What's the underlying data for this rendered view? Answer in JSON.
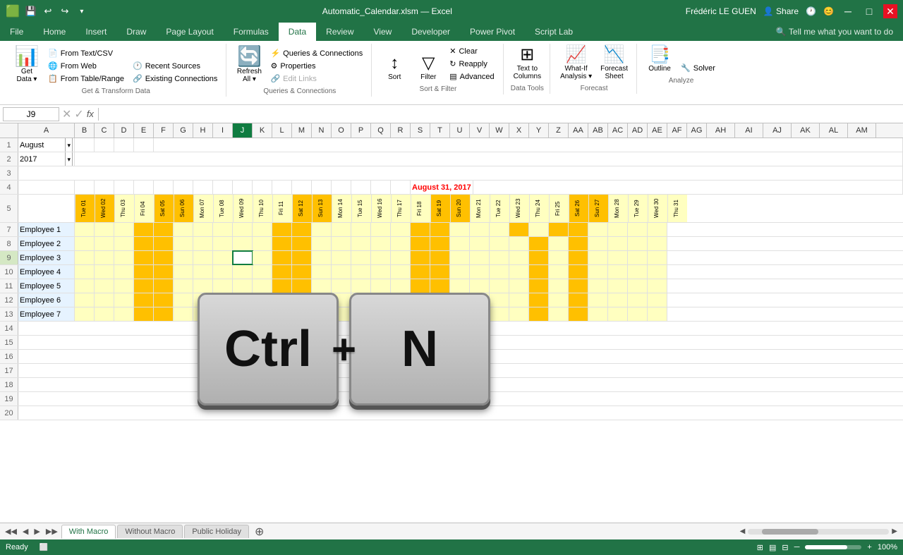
{
  "titleBar": {
    "filename": "Automatic_Calendar.xlsm — Excel",
    "user": "Frédéric LE GUEN",
    "saveIcon": "💾",
    "undoIcon": "↩",
    "redoIcon": "↪"
  },
  "ribbon": {
    "tabs": [
      "File",
      "Home",
      "Insert",
      "Draw",
      "Page Layout",
      "Formulas",
      "Data",
      "Review",
      "View",
      "Developer",
      "Power Pivot",
      "Script Lab"
    ],
    "activeTab": "Data",
    "groups": {
      "getTransform": {
        "label": "Get & Transform Data",
        "getDataBtn": "Get Data",
        "fromTextCSV": "From Text/CSV",
        "fromWeb": "From Web",
        "fromTableRange": "From Table/Range",
        "recentSources": "Recent Sources",
        "existingConnections": "Existing Connections",
        "refreshAll": "Refresh All"
      },
      "queriesConnections": {
        "label": "Queries & Connections",
        "queriesConnections": "Queries & Connections",
        "properties": "Properties",
        "editLinks": "Edit Links"
      },
      "sortFilter": {
        "label": "Sort & Filter",
        "sort": "Sort",
        "filter": "Filter",
        "clear": "Clear",
        "reapply": "Reapply",
        "advanced": "Advanced"
      },
      "dataTools": {
        "label": "Data Tools",
        "textToColumns": "Text to Columns"
      },
      "forecast": {
        "label": "Forecast",
        "whatIfAnalysis": "What-If Analysis",
        "forecastSheet": "Forecast Sheet"
      },
      "analyze": {
        "label": "Analyze",
        "solver": "Solver",
        "outline": "Outline"
      }
    }
  },
  "formulaBar": {
    "cellRef": "J9",
    "formula": ""
  },
  "sheet": {
    "colHeaders": [
      "A",
      "B",
      "C",
      "D",
      "E",
      "F",
      "G",
      "H",
      "I",
      "J",
      "K",
      "L",
      "M",
      "N",
      "O",
      "P",
      "Q",
      "R",
      "S",
      "T",
      "U",
      "V",
      "W",
      "X",
      "Y",
      "Z",
      "AA",
      "AB",
      "AC",
      "AD",
      "AE",
      "AF",
      "AG",
      "AH",
      "AI",
      "AJ",
      "AK",
      "AL",
      "AM"
    ],
    "activeCol": "J",
    "row1": {
      "A": "August",
      "dropdown": true
    },
    "row2": {
      "A": "2017",
      "dropdown": true
    },
    "row4": {
      "text": "August 31, 2017",
      "col": "S",
      "red": true
    },
    "dayHeaders": [
      "Tue 01",
      "Wed 02",
      "Thu 03",
      "Fri 04",
      "Sat 05",
      "Sun 06",
      "Mon 07",
      "Tue 08",
      "Wed 09",
      "Thu 10",
      "Fri 11",
      "Sat 12",
      "Sun 13",
      "Mon 14",
      "Tue 15",
      "Wed 16",
      "Thu 17",
      "Fri 18",
      "Sat 19",
      "Sun 20",
      "Mon 21",
      "Tue 22",
      "Wed 23",
      "Thu 24",
      "Fri 25",
      "Sat 26",
      "Sun 27",
      "Mon 28",
      "Tue 29",
      "Wed 30",
      "Thu 31"
    ],
    "employees": [
      "Employee 1",
      "Employee 2",
      "Employee 3",
      "Employee 4",
      "Employee 5",
      "Employee 6",
      "Employee 7"
    ]
  },
  "statusBar": {
    "status": "Ready",
    "zoom": "100%"
  },
  "sheetTabs": [
    "With Macro",
    "Without Macro",
    "Public Holiday"
  ],
  "activeSheet": "With Macro",
  "overlay": {
    "ctrl": "Ctrl",
    "n": "N",
    "plus": "+"
  }
}
